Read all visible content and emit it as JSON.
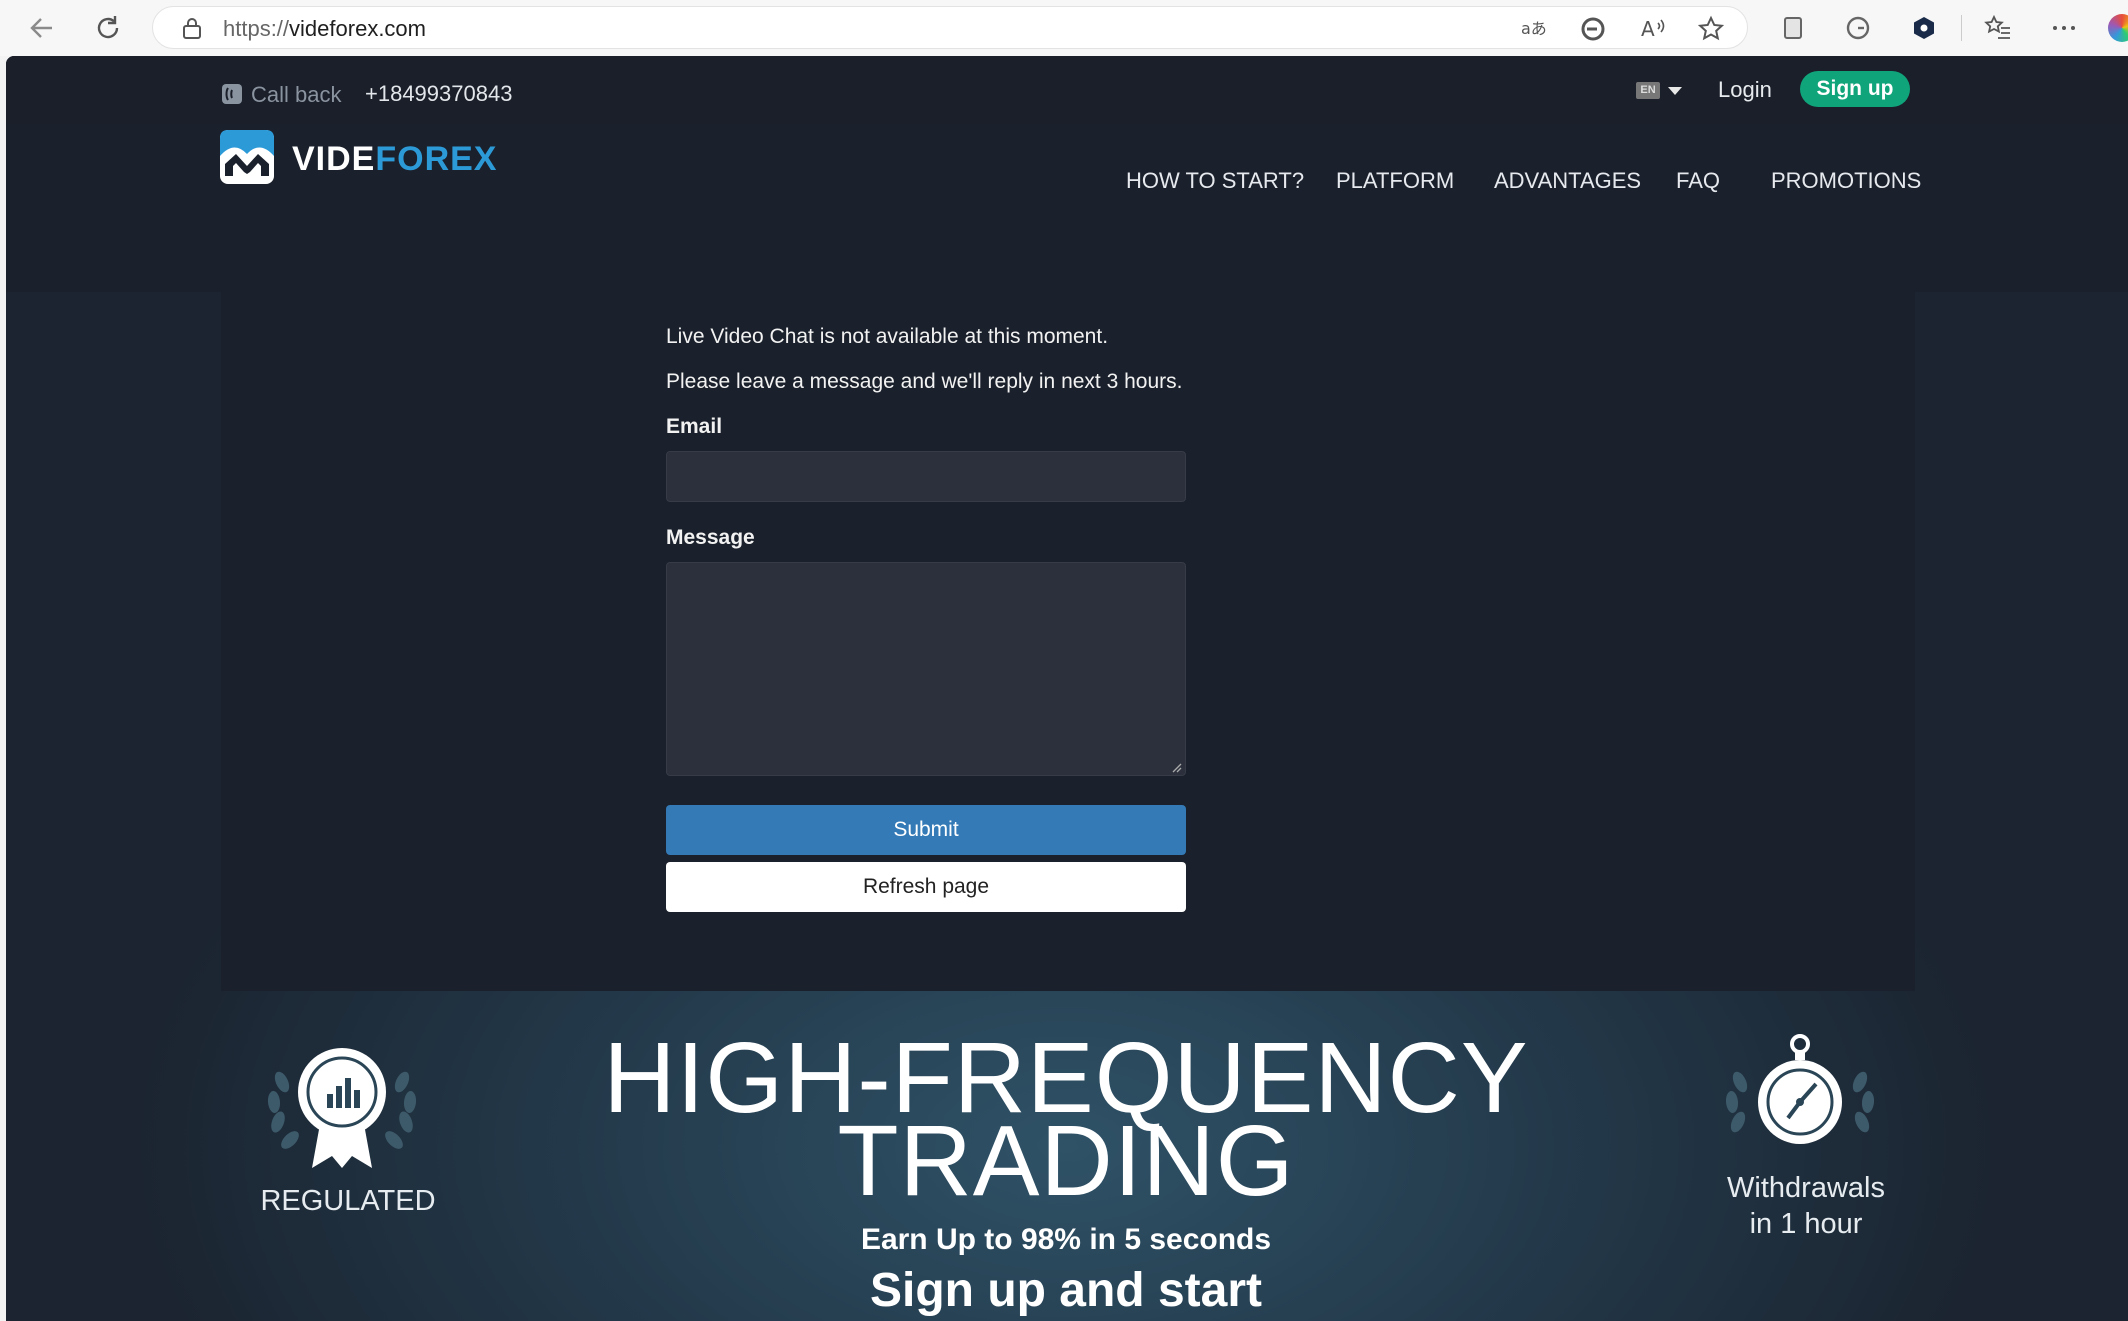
{
  "browser": {
    "url_protocol": "https://",
    "url_host": "videforex.com",
    "icons": [
      "back-icon",
      "refresh-icon",
      "lock-icon",
      "translate-icon",
      "edge-refresh-icon",
      "read-aloud-icon",
      "favorite-star-icon",
      "reading-view-icon",
      "grammarly-icon",
      "extension-icon",
      "favorites-icon",
      "more-icon"
    ]
  },
  "topbar": {
    "call_label": "Call back",
    "phone": "+18499370843",
    "lang_code": "EN",
    "login_label": "Login",
    "signup_label": "Sign up"
  },
  "logo": {
    "part1": "VIDE",
    "part2": "FOREX"
  },
  "nav": {
    "items": [
      "HOW TO START?",
      "PLATFORM",
      "ADVANTAGES",
      "FAQ",
      "PROMOTIONS"
    ]
  },
  "chat": {
    "line1": "Live Video Chat is not available at this moment.",
    "line2": "Please leave a message and we'll reply in next 3 hours.",
    "email_label": "Email",
    "email_value": "",
    "message_label": "Message",
    "message_value": "",
    "submit_label": "Submit",
    "refresh_label": "Refresh page"
  },
  "hero": {
    "title_line1": "HIGH-FREQUENCY",
    "title_line2": "TRADING",
    "subtitle": "Earn Up to 98% in 5 seconds",
    "cta": "Sign up and start",
    "badge_left": "REGULATED",
    "badge_right_line1": "Withdrawals",
    "badge_right_line2": "in 1 hour"
  },
  "colors": {
    "accent_green": "#10a47b",
    "logo_blue": "#2d9ad8",
    "submit_blue": "#337ab7",
    "panel_bg": "#1b212c"
  }
}
